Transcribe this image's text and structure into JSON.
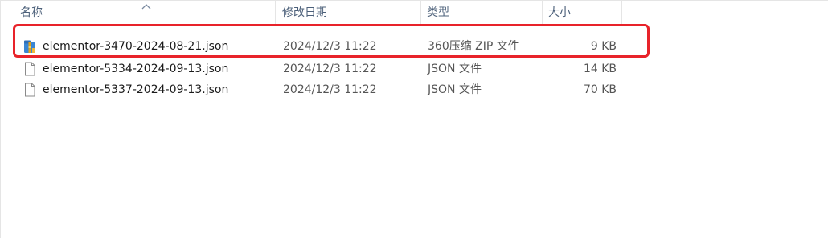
{
  "columns": {
    "name": "名称",
    "modified": "修改日期",
    "type": "类型",
    "size": "大小"
  },
  "files": [
    {
      "name": "elementor-3470-2024-08-21.json",
      "modified": "2024/12/3 11:22",
      "type": "360压缩 ZIP 文件",
      "size": "9 KB",
      "icon": "zip-archive-icon",
      "highlighted": true
    },
    {
      "name": "elementor-5334-2024-09-13.json",
      "modified": "2024/12/3 11:22",
      "type": "JSON 文件",
      "size": "14 KB",
      "icon": "json-file-icon",
      "highlighted": false
    },
    {
      "name": "elementor-5337-2024-09-13.json",
      "modified": "2024/12/3 11:22",
      "type": "JSON 文件",
      "size": "70 KB",
      "icon": "json-file-icon",
      "highlighted": false
    }
  ],
  "colors": {
    "highlight_border": "#e8232a",
    "header_text": "#4c607a"
  }
}
